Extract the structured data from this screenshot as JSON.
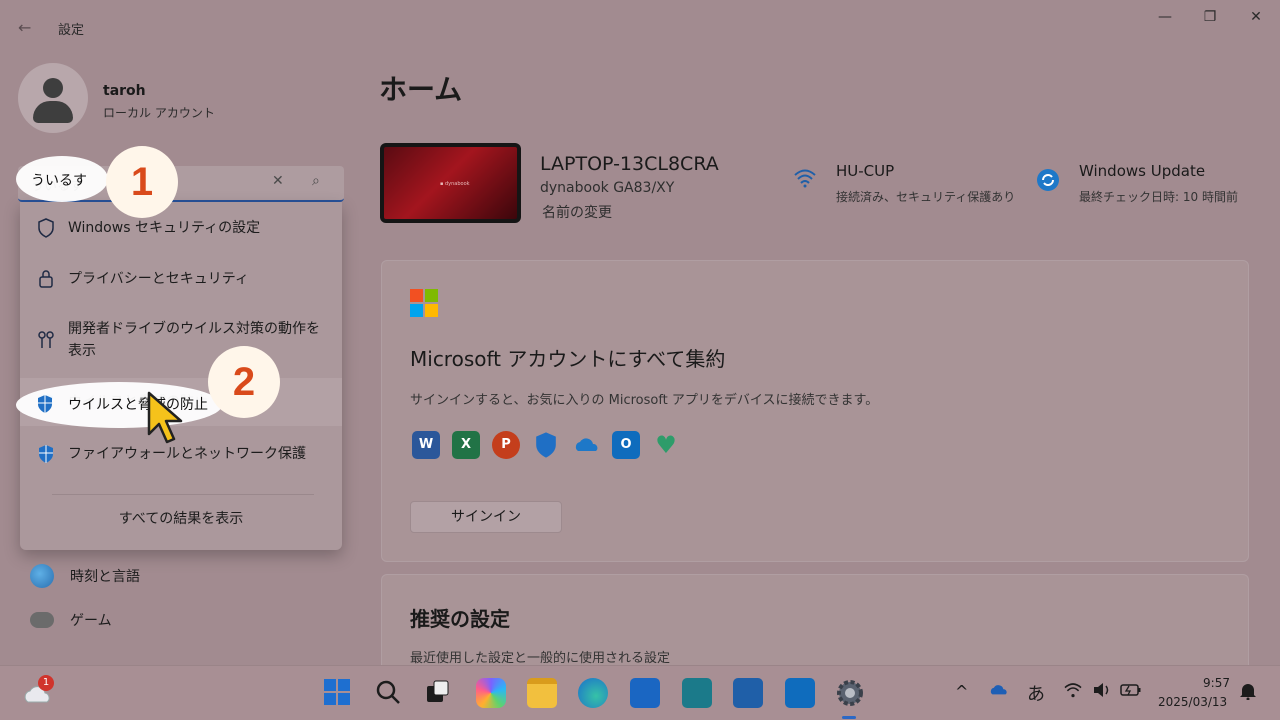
{
  "window": {
    "title": "設定",
    "back_icon": "back-arrow-icon",
    "controls": [
      "minimize-icon",
      "restore-icon",
      "close-icon"
    ]
  },
  "user": {
    "name": "taroh",
    "account_type": "ローカル アカウント"
  },
  "search": {
    "value": "ういるす",
    "clear_glyph": "✕",
    "search_glyph": "⌕"
  },
  "search_results": [
    {
      "label": "Windows セキュリティの設定",
      "icon": "shield-outline-icon"
    },
    {
      "label": "プライバシーとセキュリティ",
      "icon": "lock-icon"
    },
    {
      "label": "開発者ドライブのウイルス対策の動作を表示",
      "icon": "dev-drive-icon"
    },
    {
      "label": "ウイルスと脅威の防止",
      "icon": "shield-filled-icon"
    },
    {
      "label": "ファイアウォールとネットワーク保護",
      "icon": "shield-filled-icon"
    }
  ],
  "search_show_all": "すべての結果を表示",
  "nav": [
    {
      "label": "時刻と言語",
      "icon": "globe-clock-icon"
    },
    {
      "label": "ゲーム",
      "icon": "gamepad-icon"
    }
  ],
  "home": {
    "title": "ホーム",
    "device": {
      "name": "LAPTOP-13CL8CRA",
      "model": "dynabook GA83/XY",
      "rename": "名前の変更"
    },
    "network": {
      "name": "HU-CUP",
      "status": "接続済み、セキュリティ保護あり",
      "icon": "wifi-icon"
    },
    "update": {
      "name": "Windows Update",
      "status": "最終チェック日時: 10 時間前",
      "icon": "update-sync-icon"
    },
    "ms_card": {
      "title": "Microsoft アカウントにすべて集約",
      "description": "サインインすると、お気に入りの Microsoft アプリをデバイスに接続できます。",
      "signin_label": "サインイン",
      "apps": [
        {
          "name": "word-icon",
          "glyph": "W",
          "color": "#2b579a"
        },
        {
          "name": "excel-icon",
          "glyph": "X",
          "color": "#217346"
        },
        {
          "name": "powerpoint-icon",
          "glyph": "P",
          "color": "#c43e1c"
        },
        {
          "name": "defender-icon",
          "glyph": "",
          "color": "#1f6fc5"
        },
        {
          "name": "onedrive-icon",
          "glyph": "",
          "color": "#1e78c8"
        },
        {
          "name": "outlook-icon",
          "glyph": "O",
          "color": "#0f6cbd"
        },
        {
          "name": "family-icon",
          "glyph": "♥",
          "color": "#2e9c6a"
        }
      ]
    },
    "recommended": {
      "title": "推奨の設定",
      "description": "最近使用した設定と一般的に使用される設定"
    }
  },
  "annotations": {
    "step1": "1",
    "step2": "2"
  },
  "taskbar": {
    "weather_badge": "1",
    "ime_indicator": "あ",
    "time": "9:57",
    "date": "2025/03/13"
  }
}
